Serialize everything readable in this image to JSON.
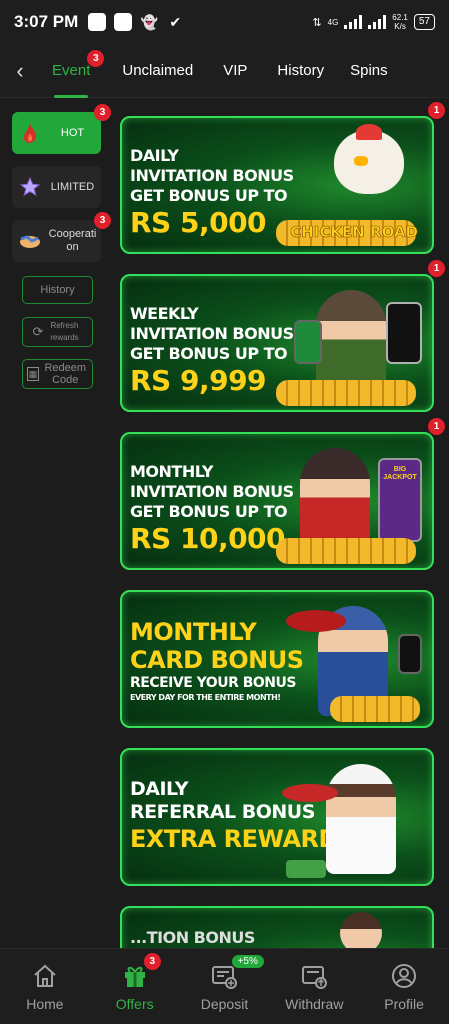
{
  "status_bar": {
    "time": "3:07 PM",
    "network": "4G",
    "speed_value": "62.1",
    "speed_unit": "K/s",
    "battery": "57"
  },
  "top_tabs": [
    {
      "label": "Event",
      "badge": "3",
      "active": true
    },
    {
      "label": "Unclaimed"
    },
    {
      "label": "VIP"
    },
    {
      "label": "History"
    },
    {
      "label": "Spins"
    }
  ],
  "sidebar": {
    "categories": [
      {
        "label": "HOT",
        "badge": "3",
        "active": true
      },
      {
        "label": "LIMITED"
      },
      {
        "label": "Cooperati on",
        "badge": "3"
      }
    ],
    "buttons": [
      {
        "label": "History"
      },
      {
        "label": "Refresh rewards"
      },
      {
        "label": "Redeem Code"
      }
    ]
  },
  "banners": [
    {
      "badge": "1",
      "line1": "DAILY",
      "line2": "INVITATION BONUS",
      "line3": "GET BONUS UP TO",
      "amount": "RS 5,000",
      "art_text": "CHICKEN ROAD"
    },
    {
      "badge": "1",
      "line1": "WEEKLY",
      "line2": "INVITATION BONUS",
      "line3": "GET BONUS UP TO",
      "amount": "RS 9,999"
    },
    {
      "badge": "1",
      "line1": "MONTHLY",
      "line2": "INVITATION BONUS",
      "line3": "GET BONUS UP TO",
      "amount": "RS 10,000",
      "art_text": "BIG JACKPOT"
    },
    {
      "line1": "MONTHLY",
      "line2": "CARD BONUS",
      "line3": "RECEIVE YOUR BONUS",
      "line4": "EVERY DAY FOR THE ENTIRE MONTH!"
    },
    {
      "line1": "DAILY",
      "line2": "REFERRAL BONUS",
      "line3": "EXTRA REWARDS"
    },
    {
      "line1": "...TION BONUS"
    }
  ],
  "bottom_nav": [
    {
      "label": "Home",
      "icon": "home-icon"
    },
    {
      "label": "Offers",
      "icon": "gift-icon",
      "badge": "3",
      "active": true
    },
    {
      "label": "Deposit",
      "icon": "deposit-icon",
      "pill": "+5%"
    },
    {
      "label": "Withdraw",
      "icon": "withdraw-icon"
    },
    {
      "label": "Profile",
      "icon": "profile-icon"
    }
  ],
  "colors": {
    "accent": "#2fb344",
    "badge": "#e0202a",
    "banner_border": "#34e05a",
    "amount": "#ffd21a"
  }
}
